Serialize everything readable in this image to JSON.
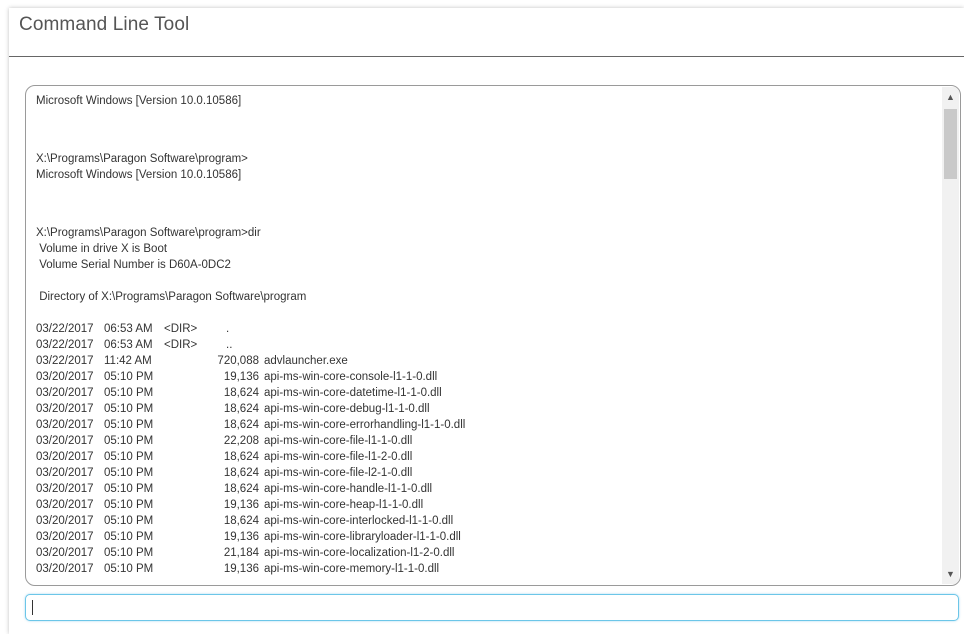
{
  "window": {
    "title": "Command Line Tool"
  },
  "console": {
    "header_lines": [
      "Microsoft Windows [Version 10.0.10586]",
      "X:\\Programs\\Paragon Software\\program>",
      "Microsoft Windows [Version 10.0.10586]",
      "X:\\Programs\\Paragon Software\\program>dir",
      " Volume in drive X is Boot",
      " Volume Serial Number is D60A-0DC2",
      " Directory of X:\\Programs\\Paragon Software\\program"
    ],
    "listing": [
      {
        "date": "03/22/2017",
        "time": "06:53 AM",
        "dir": "<DIR>",
        "size": "",
        "name": "."
      },
      {
        "date": "03/22/2017",
        "time": "06:53 AM",
        "dir": "<DIR>",
        "size": "",
        "name": ".."
      },
      {
        "date": "03/22/2017",
        "time": "11:42 AM",
        "dir": "",
        "size": "720,088",
        "name": "advlauncher.exe"
      },
      {
        "date": "03/20/2017",
        "time": "05:10 PM",
        "dir": "",
        "size": "19,136",
        "name": "api-ms-win-core-console-l1-1-0.dll"
      },
      {
        "date": "03/20/2017",
        "time": "05:10 PM",
        "dir": "",
        "size": "18,624",
        "name": "api-ms-win-core-datetime-l1-1-0.dll"
      },
      {
        "date": "03/20/2017",
        "time": "05:10 PM",
        "dir": "",
        "size": "18,624",
        "name": "api-ms-win-core-debug-l1-1-0.dll"
      },
      {
        "date": "03/20/2017",
        "time": "05:10 PM",
        "dir": "",
        "size": "18,624",
        "name": "api-ms-win-core-errorhandling-l1-1-0.dll"
      },
      {
        "date": "03/20/2017",
        "time": "05:10 PM",
        "dir": "",
        "size": "22,208",
        "name": "api-ms-win-core-file-l1-1-0.dll"
      },
      {
        "date": "03/20/2017",
        "time": "05:10 PM",
        "dir": "",
        "size": "18,624",
        "name": "api-ms-win-core-file-l1-2-0.dll"
      },
      {
        "date": "03/20/2017",
        "time": "05:10 PM",
        "dir": "",
        "size": "18,624",
        "name": "api-ms-win-core-file-l2-1-0.dll"
      },
      {
        "date": "03/20/2017",
        "time": "05:10 PM",
        "dir": "",
        "size": "18,624",
        "name": "api-ms-win-core-handle-l1-1-0.dll"
      },
      {
        "date": "03/20/2017",
        "time": "05:10 PM",
        "dir": "",
        "size": "19,136",
        "name": "api-ms-win-core-heap-l1-1-0.dll"
      },
      {
        "date": "03/20/2017",
        "time": "05:10 PM",
        "dir": "",
        "size": "18,624",
        "name": "api-ms-win-core-interlocked-l1-1-0.dll"
      },
      {
        "date": "03/20/2017",
        "time": "05:10 PM",
        "dir": "",
        "size": "19,136",
        "name": "api-ms-win-core-libraryloader-l1-1-0.dll"
      },
      {
        "date": "03/20/2017",
        "time": "05:10 PM",
        "dir": "",
        "size": "21,184",
        "name": "api-ms-win-core-localization-l1-2-0.dll"
      },
      {
        "date": "03/20/2017",
        "time": "05:10 PM",
        "dir": "",
        "size": "19,136",
        "name": "api-ms-win-core-memory-l1-1-0.dll"
      }
    ]
  },
  "scrollbar": {
    "up_icon": "chevron-up-icon",
    "down_icon": "chevron-down-icon"
  },
  "command_input": {
    "value": "",
    "placeholder": ""
  }
}
